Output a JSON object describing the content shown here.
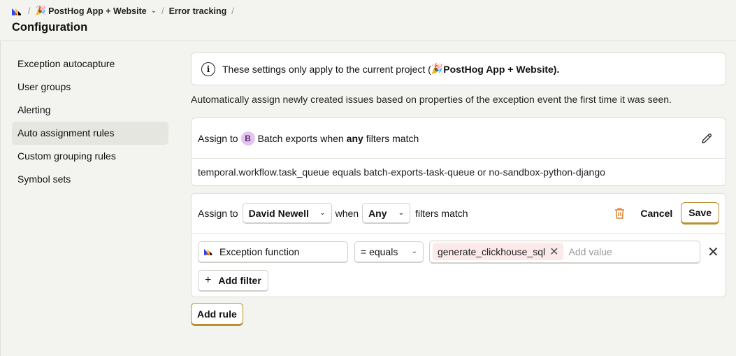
{
  "breadcrumb": {
    "project": "PostHog App + Website",
    "section": "Error tracking",
    "sep": "/"
  },
  "page_title": "Configuration",
  "sidebar": {
    "items": [
      {
        "label": "Exception autocapture"
      },
      {
        "label": "User groups"
      },
      {
        "label": "Alerting"
      },
      {
        "label": "Auto assignment rules"
      },
      {
        "label": "Custom grouping rules"
      },
      {
        "label": "Symbol sets"
      }
    ],
    "active_index": 3
  },
  "notice": {
    "prefix": "These settings only apply to the current project (",
    "project": "PostHog App + Website",
    "suffix": ")."
  },
  "description": "Automatically assign newly created issues based on properties of the exception event the first time it was seen.",
  "rule": {
    "assign_to_label": "Assign to",
    "avatar_letter": "B",
    "assignee": "Batch exports",
    "when_prefix": "when",
    "match_word": "any",
    "filters_match": "filters match",
    "condition": "temporal.workflow.task_queue equals batch-exports-task-queue or no-sandbox-python-django"
  },
  "editor": {
    "assign_to_label": "Assign to",
    "assignee": "David Newell",
    "when_label": "when",
    "match_value": "Any",
    "filters_match": "filters match",
    "cancel_label": "Cancel",
    "save_label": "Save",
    "filter": {
      "property": "Exception function",
      "operator": "= equals",
      "value_chip": "generate_clickhouse_sql",
      "value_placeholder": "Add value"
    },
    "add_filter_label": "Add filter"
  },
  "add_rule_label": "Add rule",
  "colors": {
    "background": "#f3f4ef",
    "accent_border": "#b89030",
    "trash": "#d9822b",
    "avatar_bg": "#e3c5ee",
    "chip_bg": "#fbeae9"
  }
}
